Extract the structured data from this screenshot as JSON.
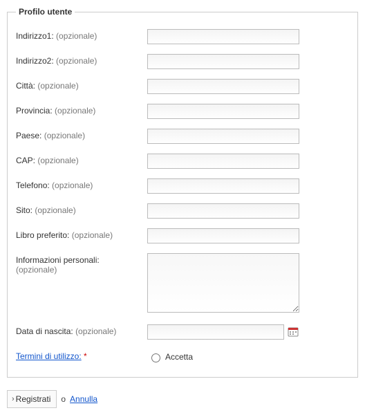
{
  "legend": "Profilo utente",
  "optional": "(opzionale)",
  "required_mark": "*",
  "fields": {
    "addr1": "Indirizzo1:",
    "addr2": "Indirizzo2:",
    "city": "Città:",
    "province": "Provincia:",
    "country": "Paese:",
    "zip": "CAP:",
    "phone": "Telefono:",
    "site": "Sito:",
    "favbook": "Libro preferito:",
    "personal": "Informazioni personali:",
    "dob": "Data di nascita:",
    "terms": "Termini di utilizzo:"
  },
  "accept_label": "Accetta",
  "footer": {
    "register": "Registrati",
    "or": "o",
    "cancel": "Annulla"
  }
}
